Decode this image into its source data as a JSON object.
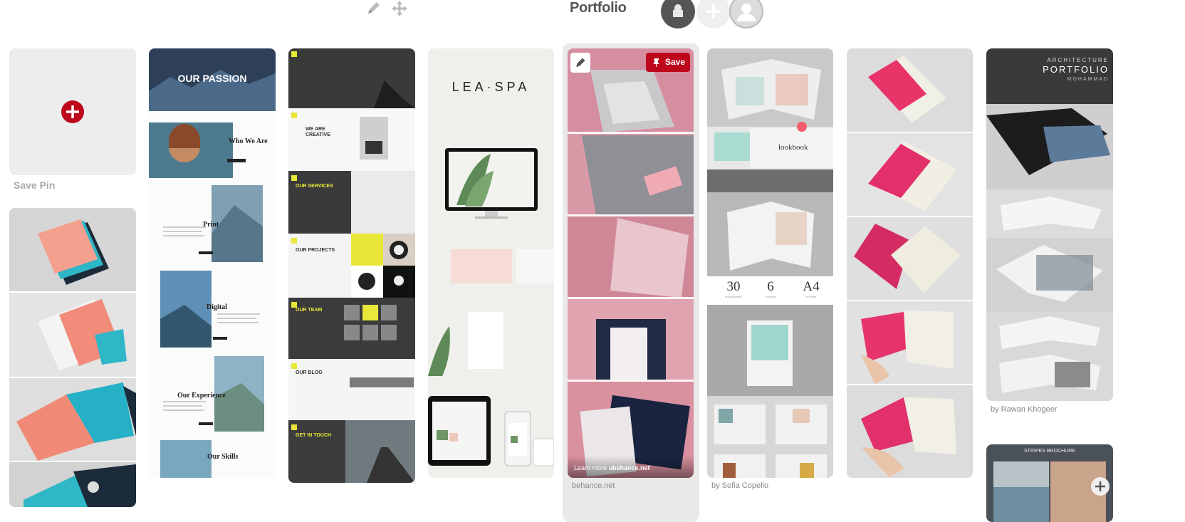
{
  "header": {
    "title": "Portfolio",
    "edit_icon": "pencil-icon",
    "move_icon": "move-arrows-icon"
  },
  "save_pin": {
    "label": "Save Pin",
    "icon": "plus-circle-icon"
  },
  "pins": [
    {
      "caption": ""
    },
    {
      "caption": "",
      "headlines": [
        "OUR PASSION",
        "Who We Are",
        "Print",
        "Digital",
        "Our Experience",
        "Our Skills"
      ]
    },
    {
      "caption": "",
      "sections": [
        "WE ARE CREATIVE",
        "OUR SERVICES",
        "OUR PROJECTS",
        "OUR TEAM",
        "OUR BLOG",
        "GET IN TOUCH"
      ]
    },
    {
      "caption": "",
      "brand": "LEA·SPA"
    },
    {
      "caption": "behance.net",
      "save_label": "Save",
      "learn_more_prefix": "Learn more at",
      "learn_more_domain": "behance.net"
    },
    {
      "caption": "by Sofia Copello",
      "stats": [
        {
          "value": "30",
          "label": "unique pages"
        },
        {
          "value": "6",
          "label": "columns"
        },
        {
          "value": "A4",
          "label": "us letter"
        }
      ],
      "cover_title": "lookbook"
    },
    {
      "caption": ""
    },
    {
      "caption": "by Rawan Khogeer",
      "cover_title": "PORTFOLIO",
      "cover_kicker": "ARCHITECTURE",
      "cover_author": "MOHAMMAD",
      "next_title": "STRIPES BROCHURE"
    }
  ],
  "colors": {
    "accent_red": "#bd081c",
    "caption_gray": "#888888",
    "pink": "#e8a3b0",
    "teal": "#2fb6c7",
    "coral": "#f08a77",
    "yellow": "#e9e83a"
  }
}
